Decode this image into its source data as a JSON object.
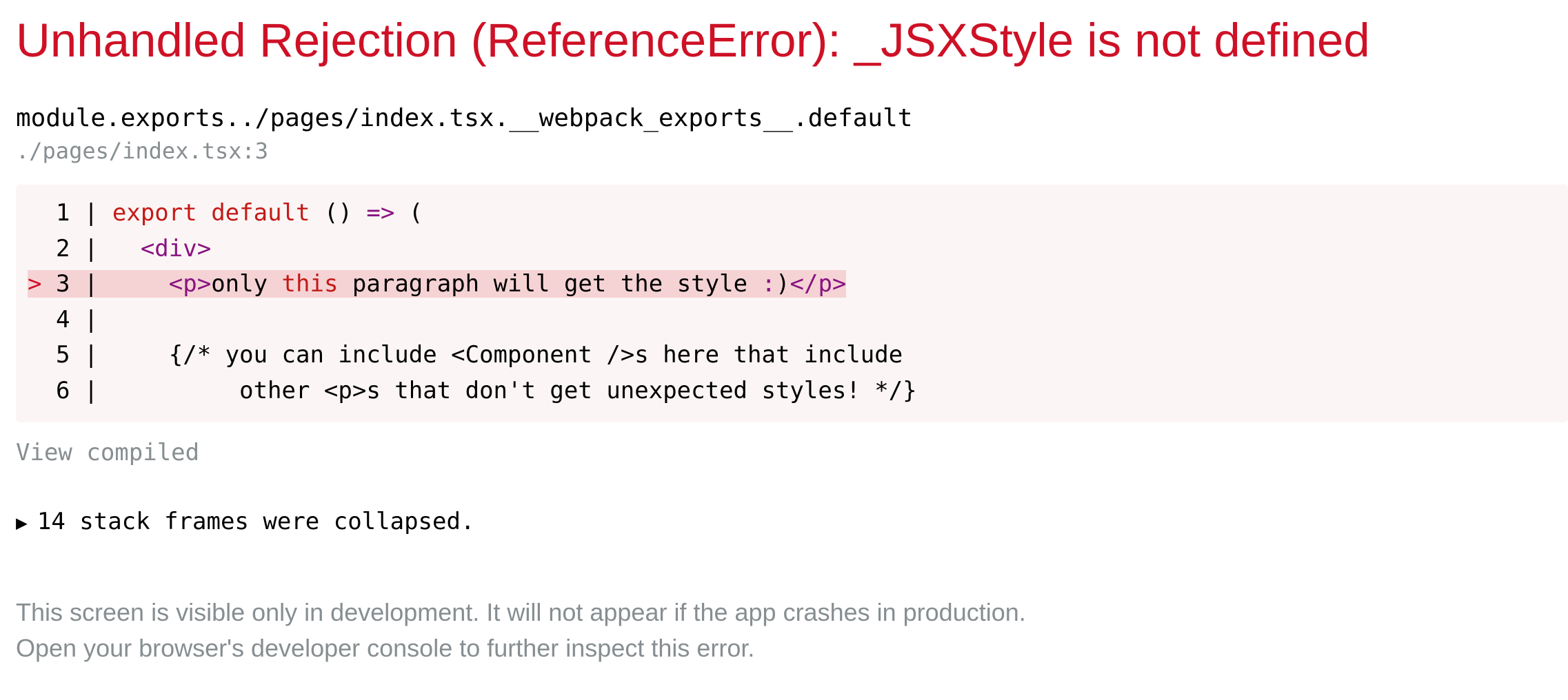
{
  "error": {
    "title": "Unhandled Rejection (ReferenceError): _JSXStyle is not defined"
  },
  "frame": {
    "function": "module.exports../pages/index.tsx.__webpack_exports__.default",
    "location": "./pages/index.tsx:3"
  },
  "code": {
    "lines": [
      {
        "marker": " ",
        "num": "1",
        "sep": " | "
      },
      {
        "marker": " ",
        "num": "2",
        "sep": " | "
      },
      {
        "marker": ">",
        "num": "3",
        "sep": " | "
      },
      {
        "marker": " ",
        "num": "4",
        "sep": " |"
      },
      {
        "marker": " ",
        "num": "5",
        "sep": " | "
      },
      {
        "marker": " ",
        "num": "6",
        "sep": " | "
      }
    ],
    "tokens": {
      "l1_kw1": "export",
      "l1_kw2": "default",
      "l1_paren": "()",
      "l1_arrow": "=>",
      "l1_open": "(",
      "l2_indent": "  ",
      "l2_tag": "<div>",
      "l3_indent": "    ",
      "l3_tag_open": "<p>",
      "l3_text1": "only ",
      "l3_kw": "this",
      "l3_text2": " paragraph will get the style ",
      "l3_colon": ":",
      "l3_paren": ")",
      "l3_tag_close": "</p>",
      "l5_text": "    {/* you can include <Component />s here that include",
      "l6_text": "         other <p>s that don't get unexpected styles! */}"
    }
  },
  "actions": {
    "view_compiled": "View compiled",
    "collapsed_triangle": "▶",
    "collapsed_text": "14 stack frames were collapsed."
  },
  "footer": {
    "line1": "This screen is visible only in development. It will not appear if the app crashes in production.",
    "line2": "Open your browser's developer console to further inspect this error."
  },
  "colors": {
    "error_red": "#ce1126",
    "muted_gray": "#878e91",
    "code_bg": "#fbf5f5",
    "highlight_bg": "#f5d3d5",
    "tag_purple": "#881280"
  }
}
